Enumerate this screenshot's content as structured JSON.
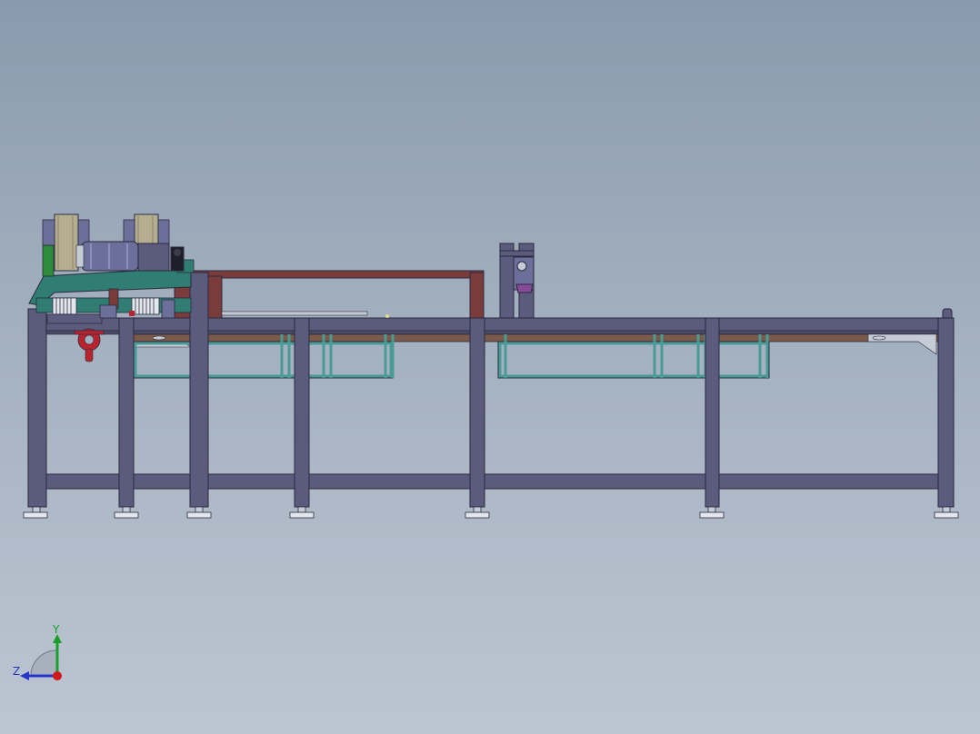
{
  "viewport": {
    "background_top": "#8a9aae",
    "background_bottom": "#bcc6d2"
  },
  "model": {
    "colors": {
      "frame": "#5b5b7d",
      "frame_edge": "#2a2a3c",
      "bracket": "#7a3b3b",
      "rail_brown": "#7b5a49",
      "teal_frame": "#4a9a98",
      "motor_teal": "#2f7d73",
      "motor_body": "#6b6f9a",
      "coil": "#b5ad8f",
      "green_block": "#2e8b3a",
      "red_hook": "#b8232e",
      "purple_part": "#8a4a9a",
      "silver": "#c6ccd6",
      "foot": "#e4e8ee"
    }
  },
  "triad": {
    "x_label": "Z",
    "y_label": "Y",
    "colors": {
      "y_axis": "#1aa02a",
      "z_axis": "#2535c8",
      "x_axis": "#d01818"
    }
  }
}
